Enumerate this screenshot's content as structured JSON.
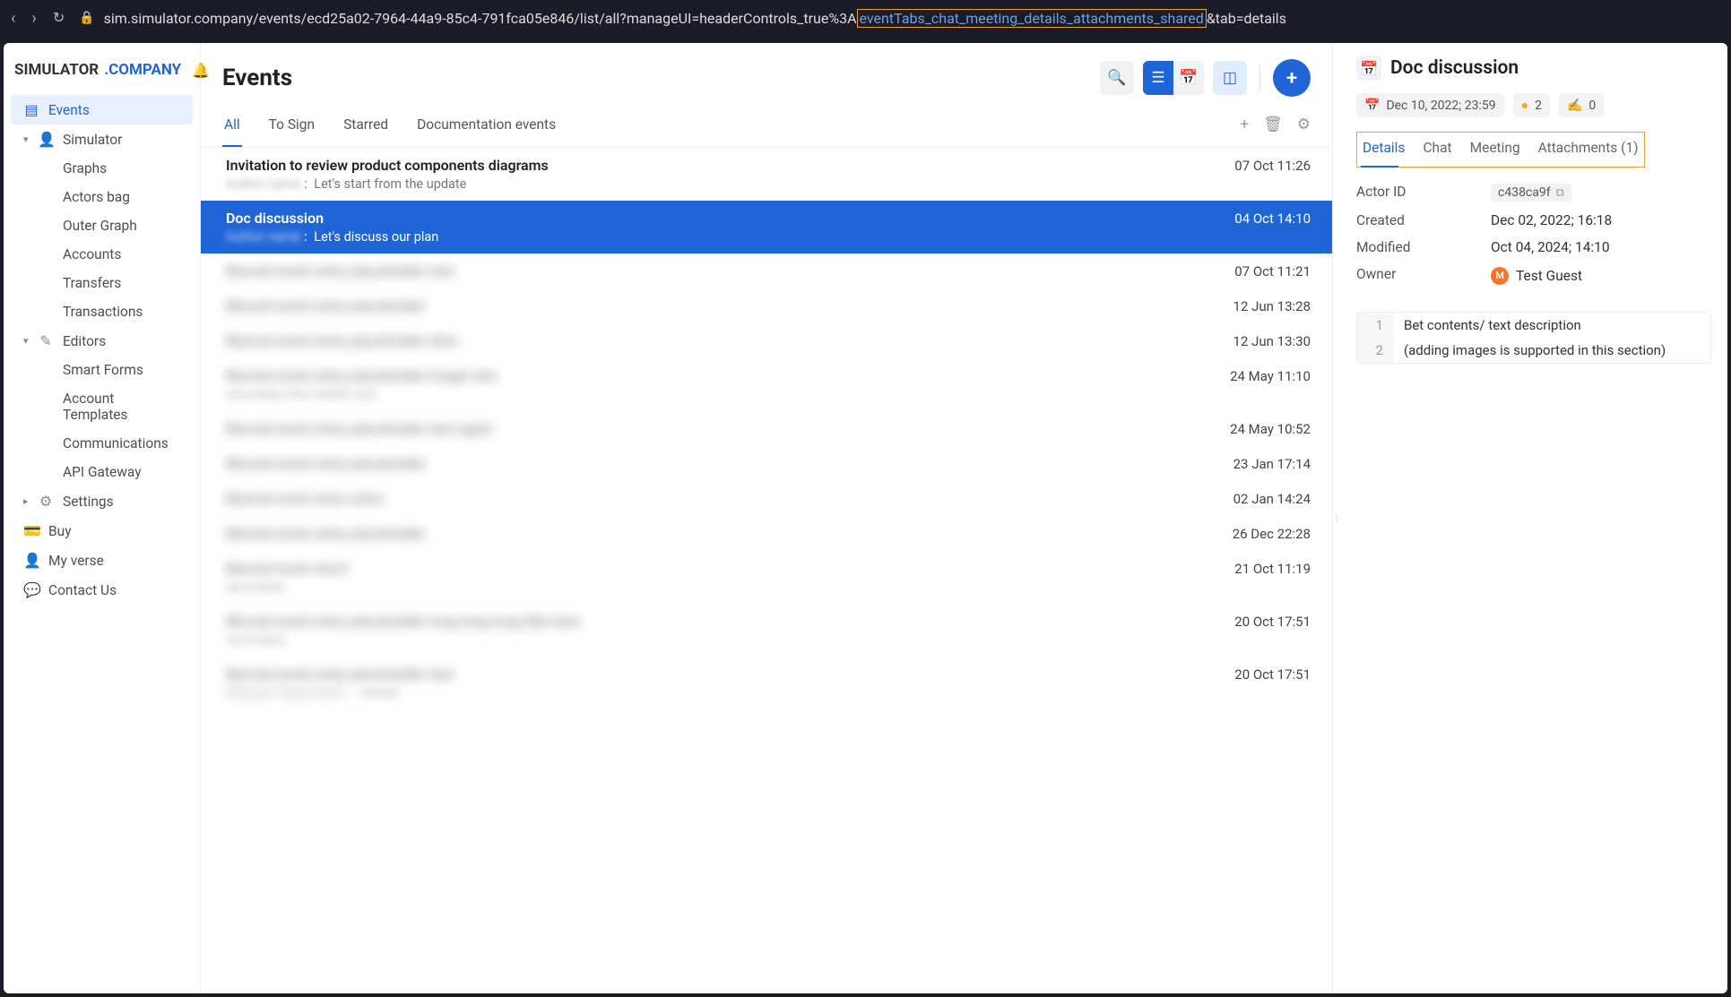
{
  "browser": {
    "url_prefix": "sim.simulator.company/events/ecd25a02-7964-44a9-85c4-791fca05e846/list/all?manageUI=headerControls_true%3A",
    "url_highlight": "eventTabs_chat_meeting_details_attachments_shared",
    "url_suffix": "&tab=details"
  },
  "brand": {
    "part1": "SIMULATOR",
    "part2": ".COMPANY"
  },
  "sidebar": {
    "events": "Events",
    "simulator": "Simulator",
    "sim_children": [
      "Graphs",
      "Actors bag",
      "Outer Graph",
      "Accounts",
      "Transfers",
      "Transactions"
    ],
    "editors": "Editors",
    "ed_children": [
      "Smart Forms",
      "Account Templates",
      "Communications",
      "API Gateway"
    ],
    "settings": "Settings",
    "buy": "Buy",
    "myverse": "My verse",
    "contact": "Contact Us"
  },
  "main": {
    "title": "Events",
    "tabs": [
      "All",
      "To Sign",
      "Starred",
      "Documentation events"
    ],
    "rows": [
      {
        "title": "Invitation to review product components diagrams",
        "sub_author": "Author name",
        "sub_text": "Let's start from the update",
        "date": "07 Oct 11:26",
        "selected": false,
        "blurred": false
      },
      {
        "title": "Doc discussion",
        "sub_author": "Author name",
        "sub_text": "Let's discuss our plan",
        "date": "04 Oct 14:10",
        "selected": true,
        "blurred": false
      },
      {
        "title": "Blurred event entry placeholder text",
        "sub_author": "",
        "sub_text": "",
        "date": "07 Oct 11:21",
        "selected": false,
        "blurred": true
      },
      {
        "title": "Blurred event entry placeholder",
        "sub_author": "",
        "sub_text": "",
        "date": "12 Jun 13:28",
        "selected": false,
        "blurred": true
      },
      {
        "title": "Blurred event entry placeholder item",
        "sub_author": "",
        "sub_text": "",
        "date": "12 Jun 13:30",
        "selected": false,
        "blurred": true
      },
      {
        "title": "Blurred event entry placeholder longer line",
        "sub_author": "",
        "sub_text": "secondary line hidden text",
        "date": "24 May 11:10",
        "selected": false,
        "blurred": true
      },
      {
        "title": "Blurred event entry placeholder text again",
        "sub_author": "",
        "sub_text": "",
        "date": "24 May 10:52",
        "selected": false,
        "blurred": true
      },
      {
        "title": "Blurred event entry placeholder",
        "sub_author": "",
        "sub_text": "",
        "date": "23 Jan 17:14",
        "selected": false,
        "blurred": true
      },
      {
        "title": "Blurred event entry short",
        "sub_author": "",
        "sub_text": "",
        "date": "02 Jan 14:24",
        "selected": false,
        "blurred": true
      },
      {
        "title": "Blurred event entry placeholder",
        "sub_author": "",
        "sub_text": "",
        "date": "26 Dec 22:28",
        "selected": false,
        "blurred": true
      },
      {
        "title": "Blurred event short",
        "sub_author": "",
        "sub_text": "secondary",
        "date": "21 Oct 11:19",
        "selected": false,
        "blurred": true
      },
      {
        "title": "Blurred event entry placeholder long long long title here",
        "sub_author": "",
        "sub_text": "secondary",
        "date": "20 Oct 17:51",
        "selected": false,
        "blurred": true
      },
      {
        "title": "Blurred event entry placeholder text",
        "sub_author": "Maksym Kapturenko",
        "sub_text": "viewed",
        "date": "20 Oct 17:51",
        "selected": false,
        "blurred": true
      }
    ]
  },
  "panel": {
    "title": "Doc discussion",
    "chip_date": "Dec 10, 2022; 23:59",
    "chip_count1": "2",
    "chip_count2": "0",
    "tabs": [
      "Details",
      "Chat",
      "Meeting",
      "Attachments (1)"
    ],
    "details": {
      "actor_label": "Actor ID",
      "actor_value": "c438ca9f",
      "created_label": "Created",
      "created_value": "Dec 02, 2022; 16:18",
      "modified_label": "Modified",
      "modified_value": "Oct 04, 2024; 14:10",
      "owner_label": "Owner",
      "owner_initial": "M",
      "owner_name": "Test Guest"
    },
    "description": [
      "Bet contents/ text description",
      "(adding images is supported in this section)"
    ]
  }
}
